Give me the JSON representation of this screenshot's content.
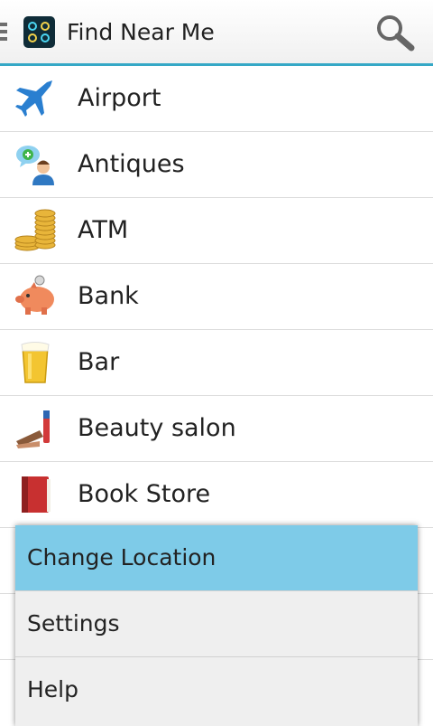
{
  "actionbar": {
    "title": "Find Near Me",
    "app_icon": "app-logo-icon",
    "search_icon": "search-icon",
    "accent_color": "#35a8c6"
  },
  "categories": [
    {
      "label": "Airport",
      "icon": "airplane-icon"
    },
    {
      "label": "Antiques",
      "icon": "person-chat-icon"
    },
    {
      "label": "ATM",
      "icon": "coins-icon"
    },
    {
      "label": "Bank",
      "icon": "piggy-bank-icon"
    },
    {
      "label": "Bar",
      "icon": "beer-glass-icon"
    },
    {
      "label": "Beauty salon",
      "icon": "cosmetics-icon"
    },
    {
      "label": "Book Store",
      "icon": "book-icon"
    }
  ],
  "menu": {
    "items": [
      {
        "label": "Change Location",
        "highlighted": true
      },
      {
        "label": "Settings",
        "highlighted": false
      },
      {
        "label": "Help",
        "highlighted": false
      }
    ],
    "highlight_color": "#7ecbe8"
  }
}
